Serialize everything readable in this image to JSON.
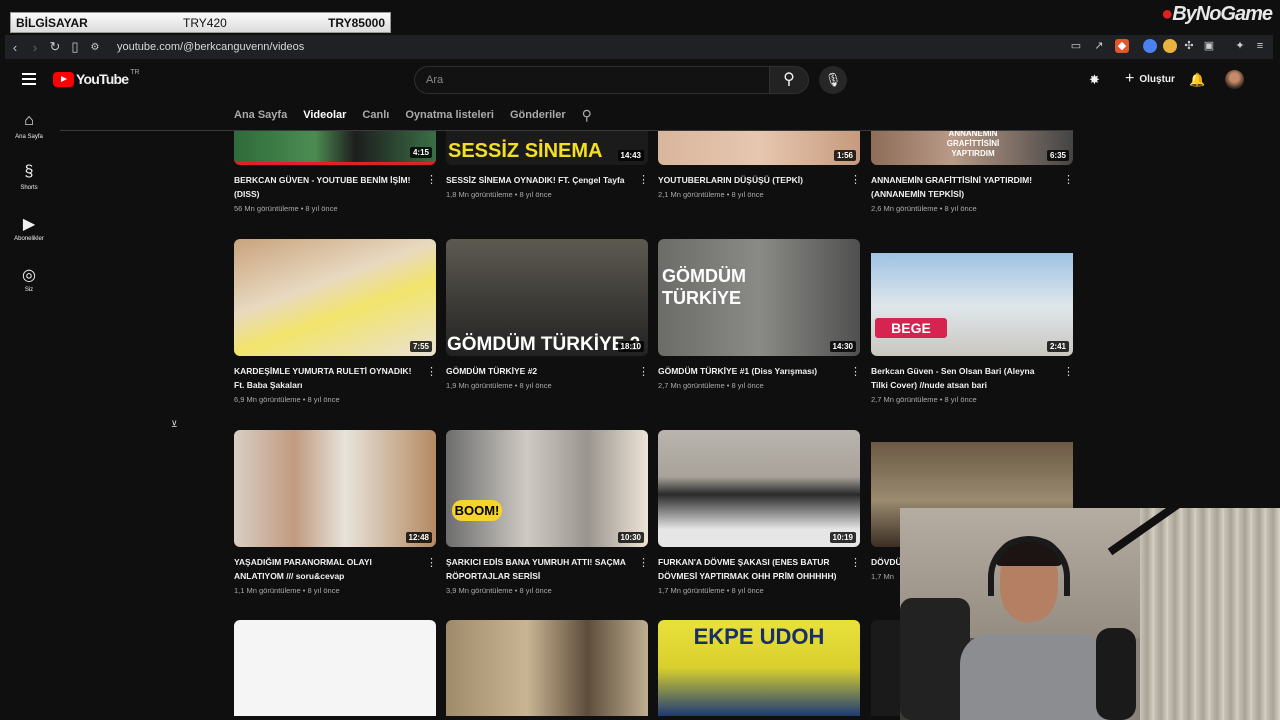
{
  "stream_overlay": {
    "left": "BİLGİSAYAR",
    "middle": "TRY420",
    "right": "TRY85000",
    "watermark": "ByNoGame"
  },
  "browser": {
    "url": "youtube.com/@berkcanguvenn/videos"
  },
  "header": {
    "logo": "YouTube",
    "region": "TR",
    "search_placeholder": "Ara",
    "create_label": "Oluştur"
  },
  "sidebar": {
    "items": [
      {
        "label": "Ana Sayfa",
        "icon": "home-icon"
      },
      {
        "label": "Shorts",
        "icon": "shorts-icon"
      },
      {
        "label": "Abonelikler",
        "icon": "subscriptions-icon"
      },
      {
        "label": "Siz",
        "icon": "you-icon"
      }
    ]
  },
  "tabs": [
    "Ana Sayfa",
    "Videolar",
    "Canlı",
    "Oynatma listeleri",
    "Gönderiler"
  ],
  "active_tab": "Videolar",
  "videos": [
    {
      "title": "BERKCAN GÜVEN - YOUTUBE BENİM İŞİM! (DISS)",
      "views": "56 Mn görüntüleme",
      "age": "8 yıl önce",
      "duration": "4:15"
    },
    {
      "title": "SESSİZ SİNEMA OYNADIK! FT. Çengel Tayfa",
      "views": "1,8 Mn görüntüleme",
      "age": "8 yıl önce",
      "duration": "14:43",
      "overlay": "SESSİZ SİNEMA"
    },
    {
      "title": "YOUTUBERLARIN DÜŞÜŞÜ (TEPKİ)",
      "views": "2,1 Mn görüntüleme",
      "age": "8 yıl önce",
      "duration": "1:56"
    },
    {
      "title": "ANNANEMİN GRAFİTTİSİNİ YAPTIRDIM! (ANNANEMİN TEPKİSİ)",
      "views": "2,6 Mn görüntüleme",
      "age": "8 yıl önce",
      "duration": "6:35",
      "overlay": "ANNANEMİN GRAFİTTİSİNİ YAPTIRDIM"
    },
    {
      "title": "KARDEŞİMLE YUMURTA RULETİ OYNADIK! Ft. Baba Şakaları",
      "views": "6,9 Mn görüntüleme",
      "age": "8 yıl önce",
      "duration": "7:55"
    },
    {
      "title": "GÖMDÜM TÜRKİYE #2",
      "views": "1,9 Mn görüntüleme",
      "age": "8 yıl önce",
      "duration": "18:10",
      "overlay": "GÖMDÜM TÜRKİYE 2"
    },
    {
      "title": "GÖMDÜM TÜRKİYE #1 (Diss Yarışması)",
      "views": "2,7 Mn görüntüleme",
      "age": "8 yıl önce",
      "duration": "14:30",
      "overlay": "GÖMDÜM TÜRKİYE"
    },
    {
      "title": "Berkcan Güven - Sen Olsan Bari (Aleyna Tilki Cover) //nude atsan bari",
      "views": "2,7 Mn görüntüleme",
      "age": "8 yıl önce",
      "duration": "2:41",
      "overlay": "BEGE"
    },
    {
      "title": "YAŞADIĞIM PARANORMAL OLAYI ANLATIYOM /// soru&cevap",
      "views": "1,1 Mn görüntüleme",
      "age": "8 yıl önce",
      "duration": "12:48"
    },
    {
      "title": "ŞARKICI EDİS BANA YUMRUH ATTI! SAÇMA RÖPORTAJLAR SERİSİ",
      "views": "3,9 Mn görüntüleme",
      "age": "8 yıl önce",
      "duration": "10:30",
      "overlay": "BOOM!"
    },
    {
      "title": "FURKAN'A DÖVME ŞAKASI (ENES BATUR DÖVMESİ YAPTIRMAK OHH PRİM OHHHHH)",
      "views": "1,7 Mn görüntüleme",
      "age": "8 yıl önce",
      "duration": "10:19"
    },
    {
      "title": "DÖVDÜ",
      "views": "1,7 Mn",
      "age": "",
      "duration": ""
    },
    {
      "title": "",
      "views": "",
      "age": "",
      "duration": ""
    },
    {
      "title": "",
      "views": "",
      "age": "",
      "duration": ""
    },
    {
      "title": "",
      "views": "",
      "age": "",
      "duration": "",
      "overlay": "EKPE UDOH"
    },
    {
      "title": "",
      "views": "",
      "age": "",
      "duration": ""
    }
  ]
}
